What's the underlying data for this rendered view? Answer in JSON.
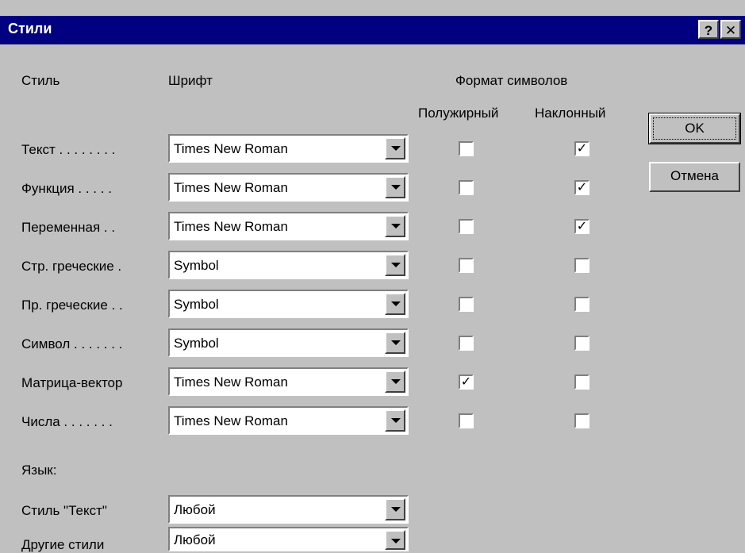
{
  "window": {
    "title": "Стили",
    "help_label": "?",
    "close_label": "✕"
  },
  "headers": {
    "style": "Стиль",
    "font": "Шрифт",
    "format": "Формат символов",
    "bold": "Полужирный",
    "italic": "Наклонный"
  },
  "rows": [
    {
      "label": "Текст . . . . . . . .",
      "font": "Times New Roman",
      "bold": "",
      "italic": "✓"
    },
    {
      "label": "Функция . . . . .",
      "font": "Times New Roman",
      "bold": "",
      "italic": "✓"
    },
    {
      "label": "Переменная . .",
      "font": "Times New Roman",
      "bold": "",
      "italic": "✓"
    },
    {
      "label": "Стр. греческие .",
      "font": "Symbol",
      "bold": "",
      "italic": ""
    },
    {
      "label": "Пр. греческие . .",
      "font": "Symbol",
      "bold": "",
      "italic": ""
    },
    {
      "label": "Символ . . . . . . .",
      "font": "Symbol",
      "bold": "",
      "italic": ""
    },
    {
      "label": "Матрица-вектор",
      "font": "Times New Roman",
      "bold": "✓",
      "italic": ""
    },
    {
      "label": "Числа . . . . . . .",
      "font": "Times New Roman",
      "bold": "",
      "italic": ""
    }
  ],
  "language": {
    "heading": "Язык:",
    "text_style_label": "Стиль \"Текст\"",
    "text_style_value": "Любой",
    "other_styles_label": "Другие стили",
    "other_styles_value": "Любой"
  },
  "buttons": {
    "ok": "OK",
    "cancel": "Отмена"
  }
}
